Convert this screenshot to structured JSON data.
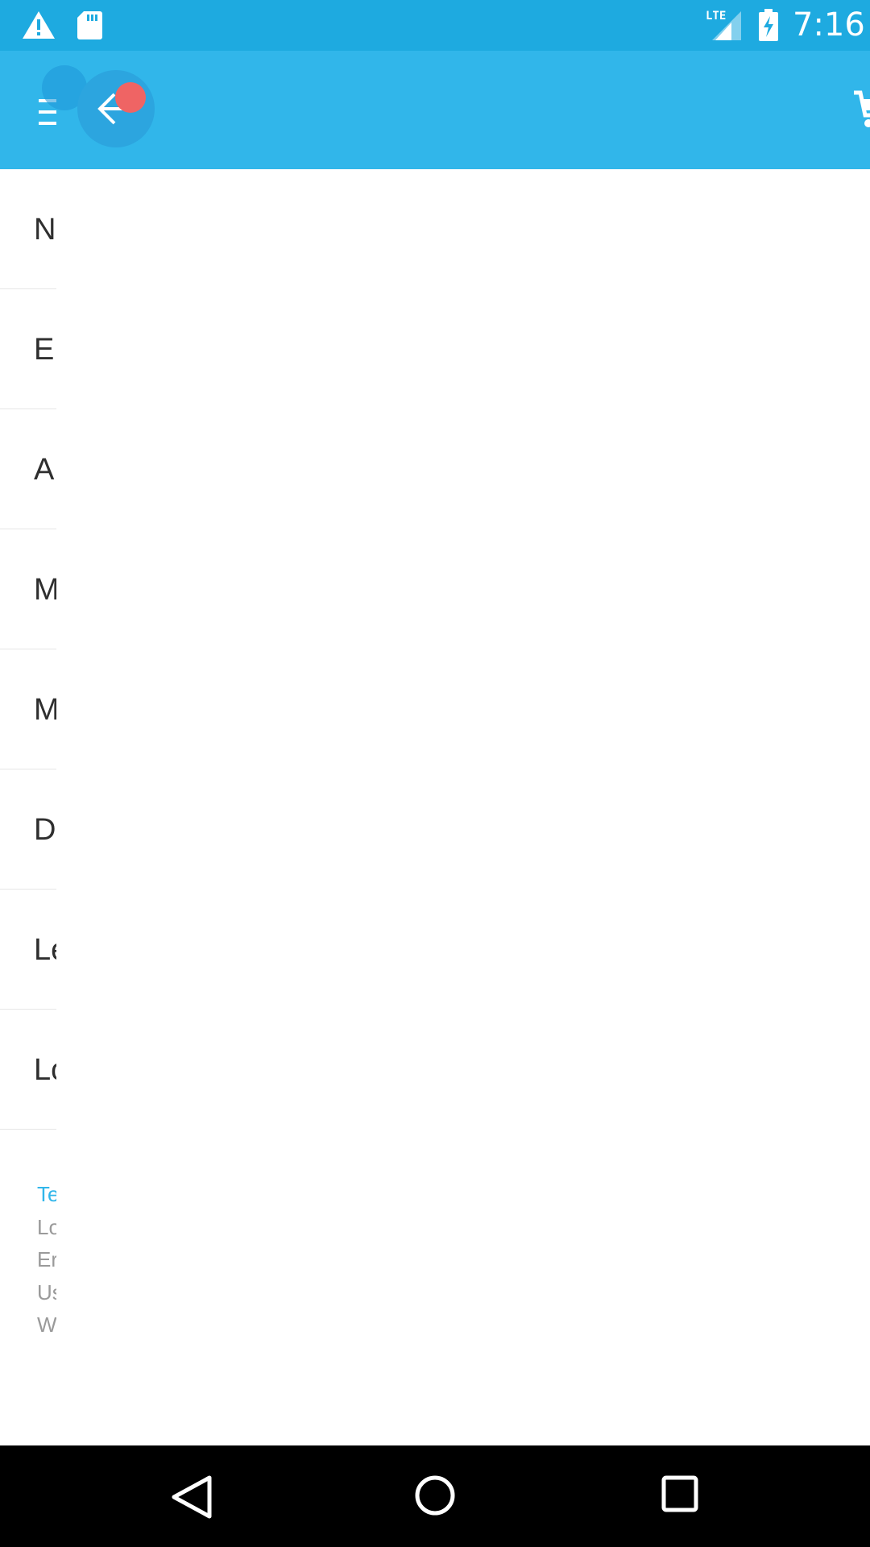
{
  "status_bar": {
    "time": "7:16",
    "network_label": "LTE",
    "icons": [
      "warning-icon",
      "sd-card-icon",
      "lte-signal-icon",
      "battery-charging-icon"
    ]
  },
  "toolbar": {
    "icons": [
      "menu-icon",
      "back-arrow-icon",
      "cart-icon"
    ],
    "accent_color": "#31b6ea",
    "status_color": "#1eaae0",
    "badge_color": "#ef6464"
  },
  "drawer": {
    "items": [
      {
        "label": "N"
      },
      {
        "label": "E"
      },
      {
        "label": "A"
      },
      {
        "label": "M"
      },
      {
        "label": "M"
      },
      {
        "label": "D"
      },
      {
        "label": "Le"
      },
      {
        "label": "Lo"
      }
    ],
    "footer_links": [
      "Te",
      "Lo",
      "Er",
      "Us",
      "W"
    ]
  },
  "nav_bar": {
    "icons": [
      "nav-back-icon",
      "nav-home-icon",
      "nav-recents-icon"
    ]
  }
}
